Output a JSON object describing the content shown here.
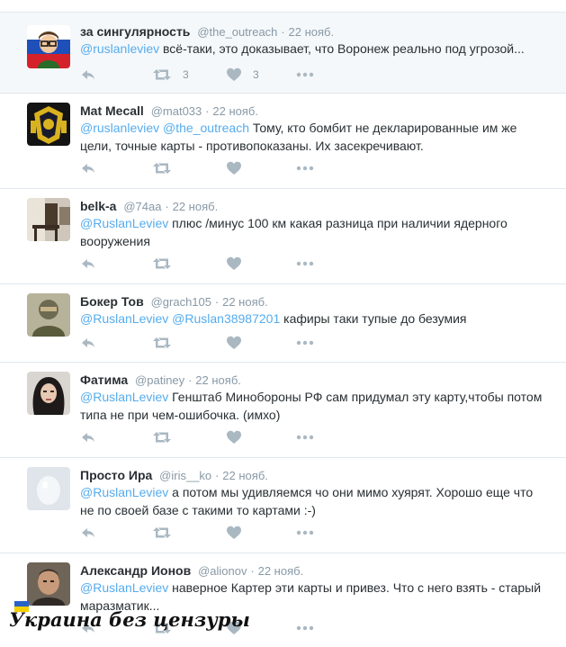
{
  "tweets": [
    {
      "name": "за сингулярность",
      "handle": "@the_outreach",
      "time": "22 нояб.",
      "mentions": [
        "@ruslanleviev"
      ],
      "text": " всё-таки, это доказывает, что Воронеж реально под угрозой...",
      "retweets": "3",
      "likes": "3",
      "avatar": "flag-avatar"
    },
    {
      "name": "Mat Mecall",
      "handle": "@mat033",
      "time": "22 нояб.",
      "mentions": [
        "@ruslanleviev",
        "@the_outreach"
      ],
      "text": "  Тому, кто бомбит не декларированные им же цели, точные карты - противопоказаны.  Их засекречивают.",
      "retweets": "",
      "likes": "",
      "avatar": "emblem-avatar"
    },
    {
      "name": "belk-a",
      "handle": "@74aa",
      "time": "22 нояб.",
      "mentions": [
        "@RuslanLeviev"
      ],
      "text": " плюс /минус 100 км какая разница при наличии ядерного вооружения",
      "retweets": "",
      "likes": "",
      "avatar": "room-avatar"
    },
    {
      "name": "Бокер Тов",
      "handle": "@grach105",
      "time": "22 нояб.",
      "mentions": [
        "@RuslanLeviev",
        "@Ruslan38987201"
      ],
      "text": " кафиры таки тупые до безумия",
      "retweets": "",
      "likes": "",
      "avatar": "masked-avatar"
    },
    {
      "name": "Фатима",
      "handle": "@patiney",
      "time": "22 нояб.",
      "mentions": [
        "@RuslanLeviev"
      ],
      "text": " Генштаб Минобороны РФ сам придумал эту карту,чтобы потом типа не при чем-ошибочка. (имхо)",
      "retweets": "",
      "likes": "",
      "avatar": "woman-avatar"
    },
    {
      "name": "Просто Ира",
      "handle": "@iris__ko",
      "time": "22 нояб.",
      "mentions": [
        "@RuslanLeviev"
      ],
      "text": " а потом мы удивляемся чо они мимо хуярят. Хорошо еще что не по своей базе с такими то картами :-)",
      "retweets": "",
      "likes": "",
      "avatar": "default-egg-avatar"
    },
    {
      "name": "Александр Ионов",
      "handle": "@alionov",
      "time": "22 нояб.",
      "mentions": [
        "@RuslanLeviev"
      ],
      "text": " наверное Картер эти карты и привез. Что с него взять - старый маразматик...",
      "retweets": "",
      "likes": "",
      "avatar": "man-avatar"
    }
  ],
  "separator": "·",
  "watermark": "Украина без цензуры",
  "colors": {
    "accent": "#55acee",
    "muted": "#8899a6",
    "text": "#292f33",
    "highlight_bg": "#f5f8fa"
  },
  "icons": [
    "reply-icon",
    "retweet-icon",
    "heart-icon",
    "more-icon"
  ]
}
